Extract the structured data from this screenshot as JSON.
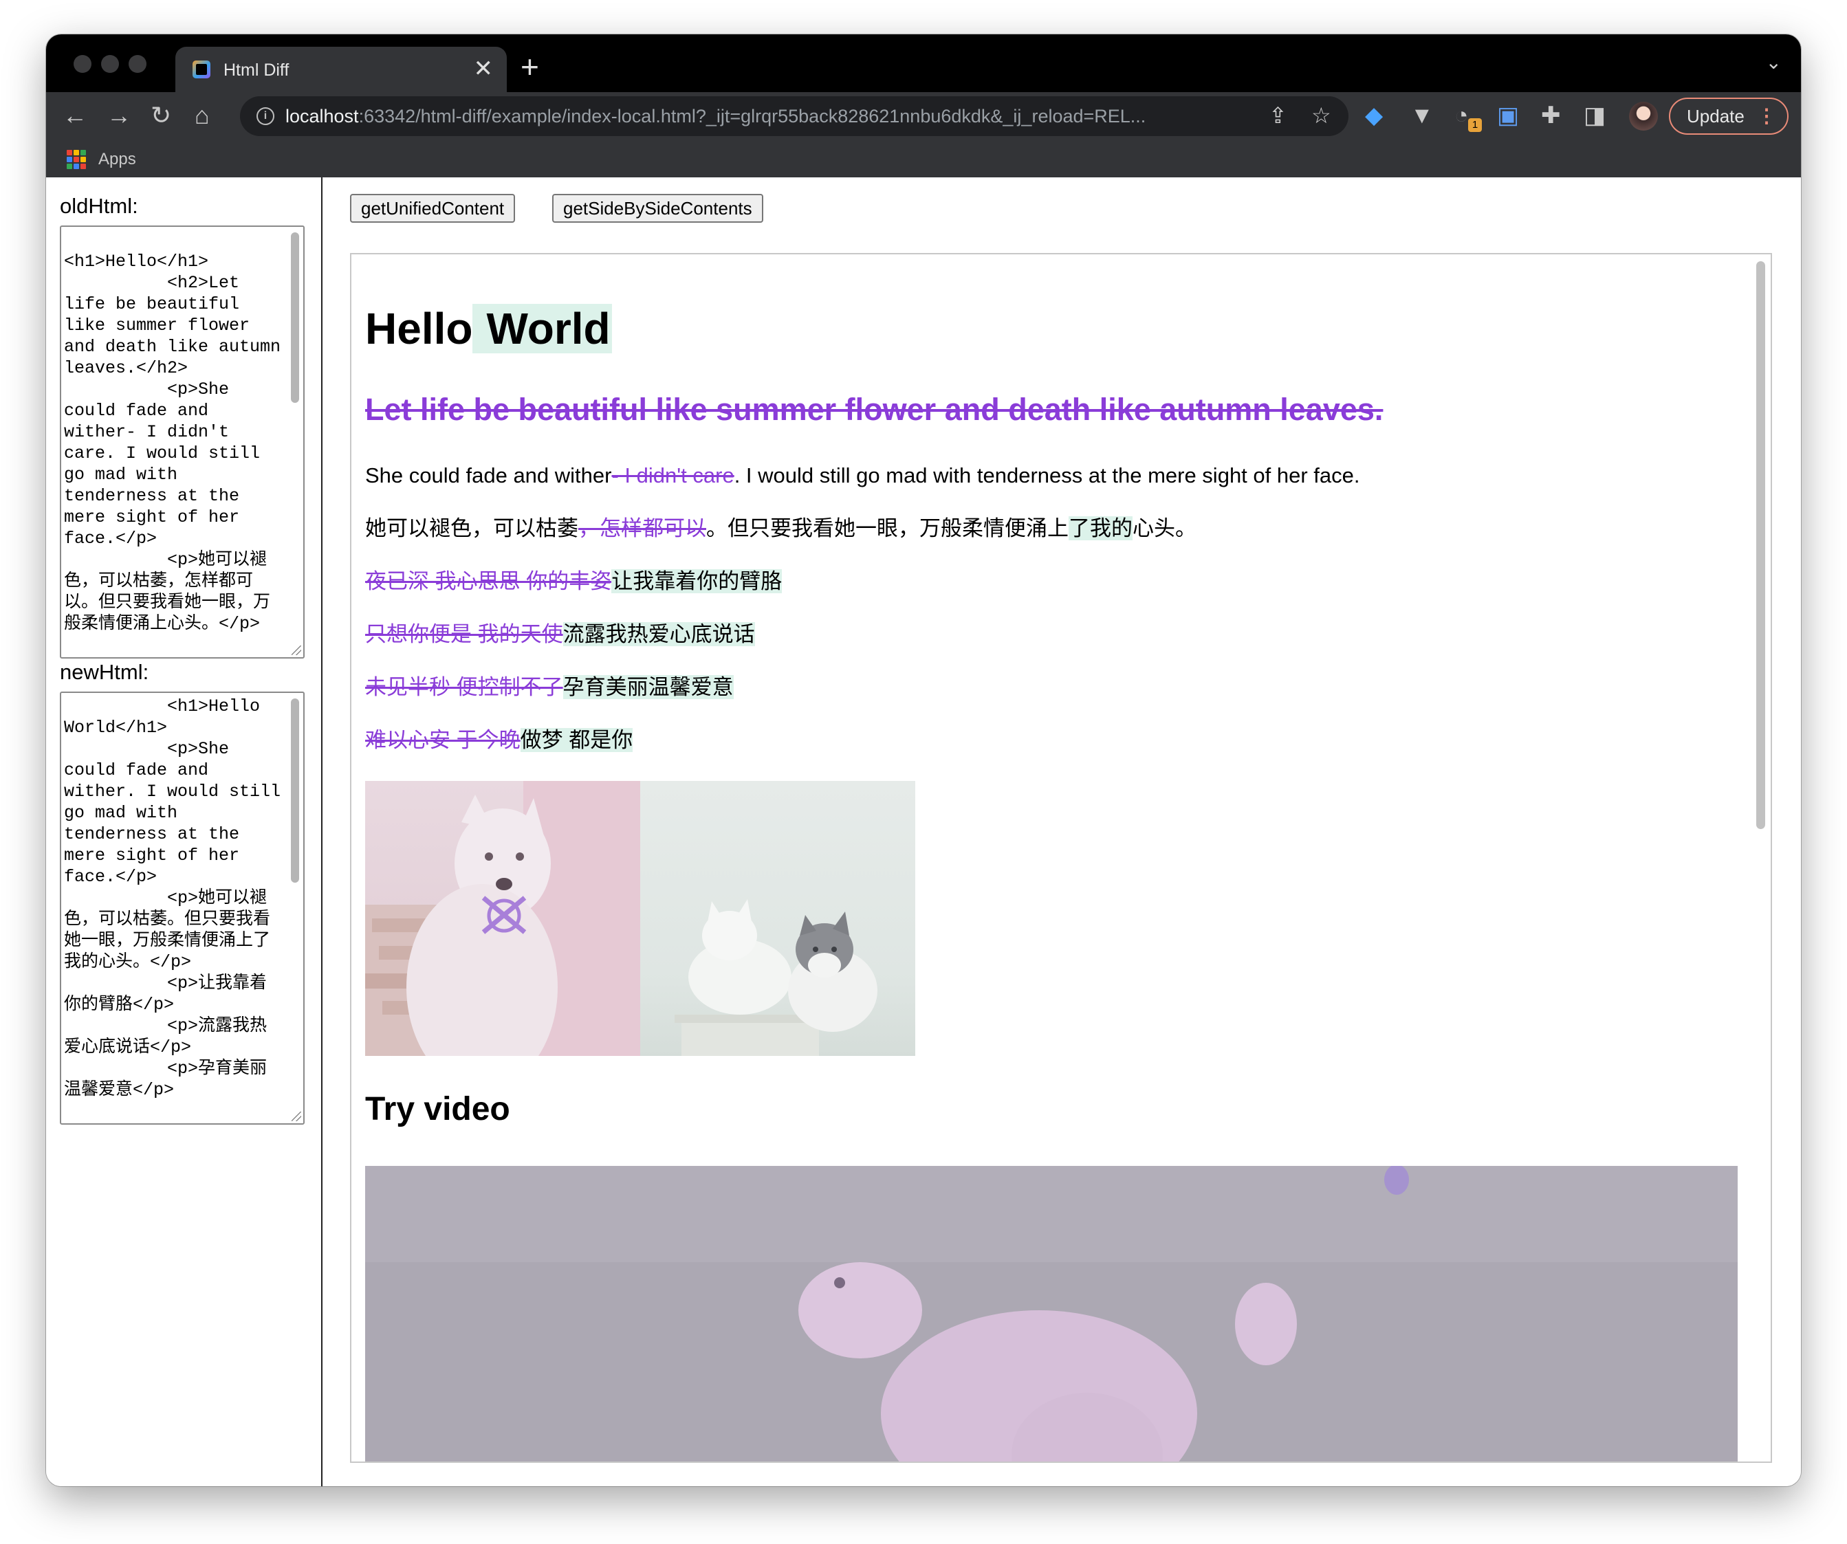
{
  "browser": {
    "tab_title": "Html Diff",
    "url_host": "localhost",
    "url_rest": ":63342/html-diff/example/index-local.html?_ijt=glrqr55back828621nnbu6dkdk&_ij_reload=REL...",
    "update_label": "Update",
    "extension_badge": "1",
    "bookmarks_apps_label": "Apps"
  },
  "left_panel": {
    "old_label": "oldHtml:",
    "old_value": "\n<h1>Hello</h1>\n          <h2>Let life be beautiful like summer flower and death like autumn leaves.</h2>\n          <p>She could fade and wither- I didn't care. I would still go mad with tenderness at the mere sight of her face.</p>\n          <p>她可以褪色，可以枯萎，怎样都可以。但只要我看她一眼，万般柔情便涌上心头。</p>",
    "new_label": "newHtml:",
    "new_value": "          <h1>Hello World</h1>\n          <p>She could fade and wither. I would still go mad with tenderness at the mere sight of her face.</p>\n          <p>她可以褪色，可以枯萎。但只要我看她一眼，万般柔情便涌上了我的心头。</p>\n          <p>让我靠着你的臂胳</p>\n          <p>流露我热爱心底说话</p>\n          <p>孕育美丽温馨爱意</p>"
  },
  "buttons": {
    "unified": "getUnifiedContent",
    "side_by_side": "getSideBySideContents"
  },
  "diff": {
    "h1_base": "Hello",
    "h1_ins": "World",
    "h2_del": "Let life be beautiful like summer flower and death like autumn leaves.",
    "p1_a": "She could fade and wither",
    "p1_del": "- I didn't care",
    "p1_b": ". I would still go mad with tenderness at the mere sight of her face.",
    "p2_a": "她可以褪色，可以枯萎",
    "p2_del": "，怎样都可以",
    "p2_b": "。但只要我看她一眼，万般柔情便涌上",
    "p2_ins": "了我的",
    "p2_c": "心头。",
    "p3_del": "夜已深 我心思思 你的丰姿",
    "p3_ins": "让我靠着你的臂胳",
    "p4_del": "只想你便是 我的天使",
    "p4_ins": "流露我热爱心底说话",
    "p5_del": "未见半秒 便控制不了",
    "p5_ins": "孕育美丽温馨爱意",
    "p6_del": "难以心安 于今晚",
    "p6_ins": "做梦 都是你",
    "video_heading": "Try video"
  },
  "colors": {
    "inserted_bg": "#dcf2ea",
    "deleted_text": "#8a3cd8",
    "browser_frame": "#333437",
    "update_border": "#e98b78"
  }
}
